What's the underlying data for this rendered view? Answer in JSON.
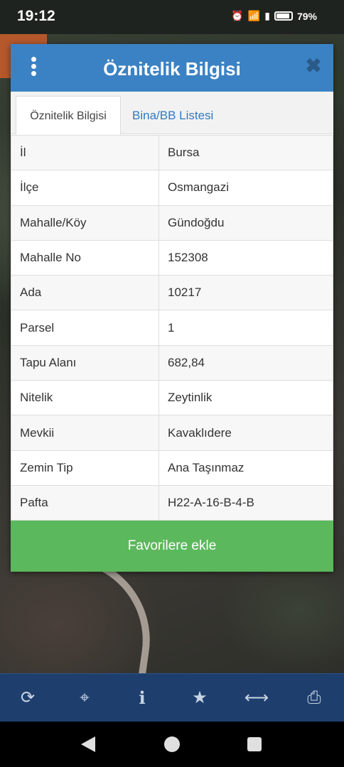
{
  "status_bar": {
    "time": "19:12",
    "battery_percent": "79%"
  },
  "dialog": {
    "title": "Öznitelik Bilgisi",
    "close_label": "✖",
    "tabs": [
      {
        "label": "Öznitelik Bilgisi",
        "active": true
      },
      {
        "label": "Bina/BB Listesi",
        "active": false
      }
    ],
    "rows": [
      {
        "key": "İl",
        "value": "Bursa"
      },
      {
        "key": "İlçe",
        "value": "Osmangazi"
      },
      {
        "key": "Mahalle/Köy",
        "value": "Gündoğdu"
      },
      {
        "key": "Mahalle No",
        "value": "152308"
      },
      {
        "key": "Ada",
        "value": "10217"
      },
      {
        "key": "Parsel",
        "value": "1"
      },
      {
        "key": "Tapu Alanı",
        "value": "682,84"
      },
      {
        "key": "Nitelik",
        "value": "Zeytinlik"
      },
      {
        "key": "Mevkii",
        "value": "Kavaklıdere"
      },
      {
        "key": "Zemin Tip",
        "value": "Ana Taşınmaz"
      },
      {
        "key": "Pafta",
        "value": "H22-A-16-B-4-B"
      }
    ],
    "favorite_button": "Favorilere ekle"
  },
  "toolbar": {
    "icons": [
      "refresh-icon",
      "locate-icon",
      "info-icon",
      "star-icon",
      "measure-icon",
      "print-icon"
    ]
  },
  "colors": {
    "header": "#3b82c4",
    "favorite_button": "#5cb85c",
    "toolbar": "#1e3f6e",
    "tab_link": "#3478c0"
  }
}
